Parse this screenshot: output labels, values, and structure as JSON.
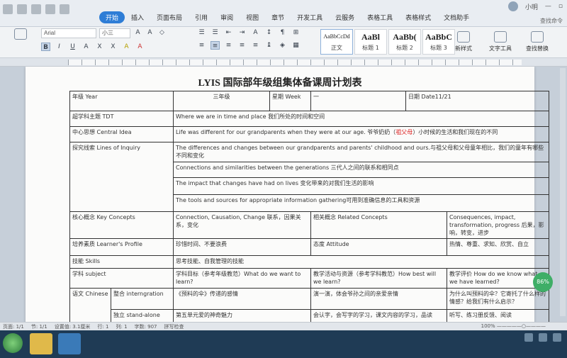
{
  "menu": {
    "tabs": [
      "开始",
      "插入",
      "页面布局",
      "引用",
      "审阅",
      "视图",
      "章节",
      "开发工具",
      "云服务",
      "表格工具",
      "表格样式",
      "文档助手"
    ],
    "active_tab": "开始",
    "user": "小明",
    "search_hint": "查找命令"
  },
  "ribbon": {
    "font_name": "Arial",
    "font_size": "小三",
    "styles": [
      {
        "sample": "AaBbCcDd",
        "label": "正文"
      },
      {
        "sample": "AaBl",
        "label": "标题 1"
      },
      {
        "sample": "AaBb(",
        "label": "标题 2"
      },
      {
        "sample": "AaBbC",
        "label": "标题 3"
      }
    ],
    "new_style": "新样式",
    "text_tools": "文字工具",
    "find_replace": "查找替换"
  },
  "doc": {
    "title": "LYIS 国际部年级组集体备课周计划表",
    "grade_label": "年级 Year",
    "grade_value": "三年级",
    "week_label": "星期 Week",
    "week_value": "一",
    "date_label": "日期 Date11/21",
    "tdt_label": "超学科主题 TDT",
    "tdt_value": "Where we are in time and place 我们所处的时间和空间",
    "ci_label": "中心思想 Central Idea",
    "ci_value_a": "Life was different for our grandparents when they were at our age. 爷爷奶奶（",
    "ci_value_red": "祖父母",
    "ci_value_b": "）小时候的生活和我们现在的不同",
    "loi_label": "探究线索 Lines of Inquiry",
    "loi_1": "The differences and changes between our grandparents and parents' childhood and ours.与祖父母和父母童年相比，我们的童年有哪些不同和变化",
    "loi_2": "Connections and similarities between the generations 三代人之间的联系和相同点",
    "loi_3": "The impact that changes have had on lives 变化带来的对我们生活的影响",
    "loi_4": "The tools and sources for appropriate information gathering可用到准确信息的工具和资源",
    "kc_label": "核心概念 Key Concepts",
    "kc_1": "Connection, Causation, Change 联系，因果关系，变化",
    "kc_2": "相关概念 Related Concepts",
    "kc_3": "Consequences, impact, transformation, progress 后果，影响，转变，进步",
    "lp_label": "培养素质 Learner's Profile",
    "lp_value": "珍惜时间、不要浪费",
    "att_label": "态度 Attitude",
    "att_value": "热情、尊重、求知、欣赏、自立",
    "sk_label": "技能 Skills",
    "sk_value": "思考技能、自我管理的技能",
    "subj_label": "学科 subject",
    "subj_goal": "学科目标（参考年级教范）What do we want to learn?",
    "subj_act": "教学活动与资源（参考学科教范）How best will we learn?",
    "subj_eval": "教学评价 How do we know what we have learned?",
    "lang_label": "语文 Chinese",
    "int_label": "整合 interngration",
    "int_goal": "《预料的伞》传递的感情",
    "int_act": "演一演，体会爷孙之间的亲爱亲情",
    "int_eval": "为什么叫预料的伞？它寄托了什么样的情感？给我们有什么启示？",
    "sa_label": "独立 stand-alone",
    "sa_goal": "第五单元爱的神奇魅力",
    "sa_act": "会认字，会写字的学习，课文内容的学习，品读",
    "sa_eval": "听写、练习册反馈、阅读"
  },
  "status": {
    "pages": "页面: 1/1",
    "section": "节: 1/1",
    "pos": "设置值: 3.1厘米",
    "line": "行: 1",
    "col": "列: 1",
    "words": "字数: 907",
    "spell": "拼写检查",
    "zoom": "100%"
  },
  "badge": "86%"
}
